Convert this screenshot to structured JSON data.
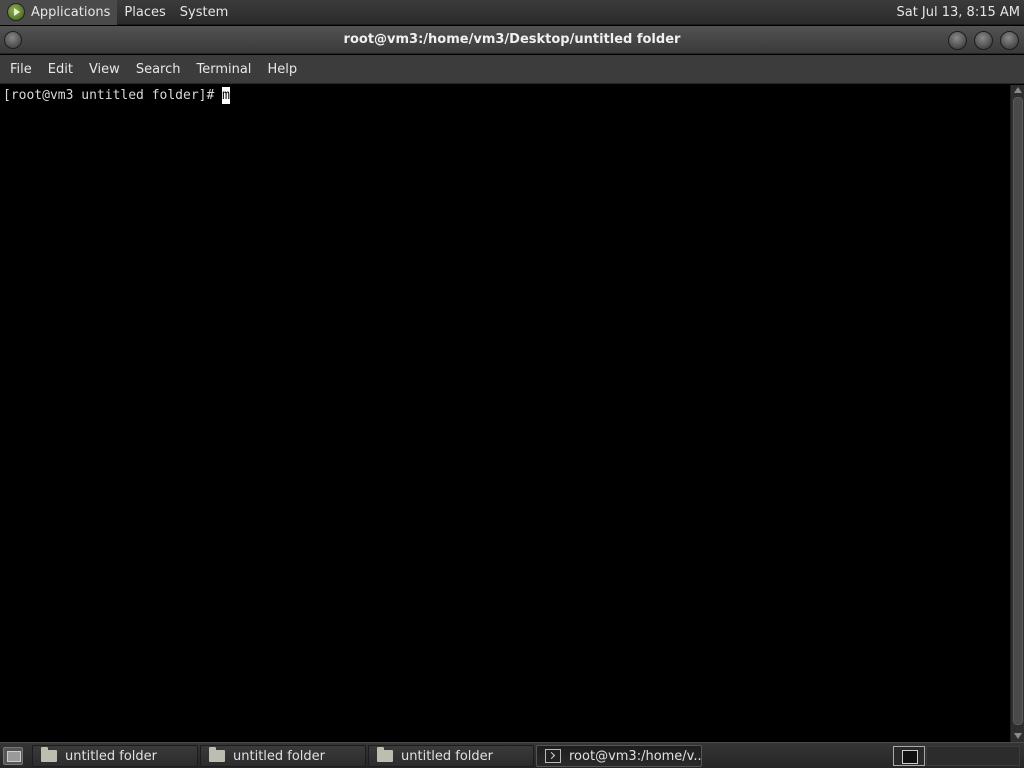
{
  "top_panel": {
    "menus": [
      "Applications",
      "Places",
      "System"
    ],
    "clock": "Sat Jul 13,  8:15 AM"
  },
  "window": {
    "title": "root@vm3:/home/vm3/Desktop/untitled folder"
  },
  "menubar": {
    "items": [
      "File",
      "Edit",
      "View",
      "Search",
      "Terminal",
      "Help"
    ]
  },
  "terminal": {
    "prompt": "[root@vm3 untitled folder]# ",
    "input": "m"
  },
  "taskbar": {
    "tasks": [
      {
        "label": "untitled folder",
        "icon": "folder-icon"
      },
      {
        "label": "untitled folder",
        "icon": "folder-icon"
      },
      {
        "label": "untitled folder",
        "icon": "folder-icon"
      },
      {
        "label": "root@vm3:/home/v...",
        "icon": "terminal-icon"
      }
    ]
  }
}
